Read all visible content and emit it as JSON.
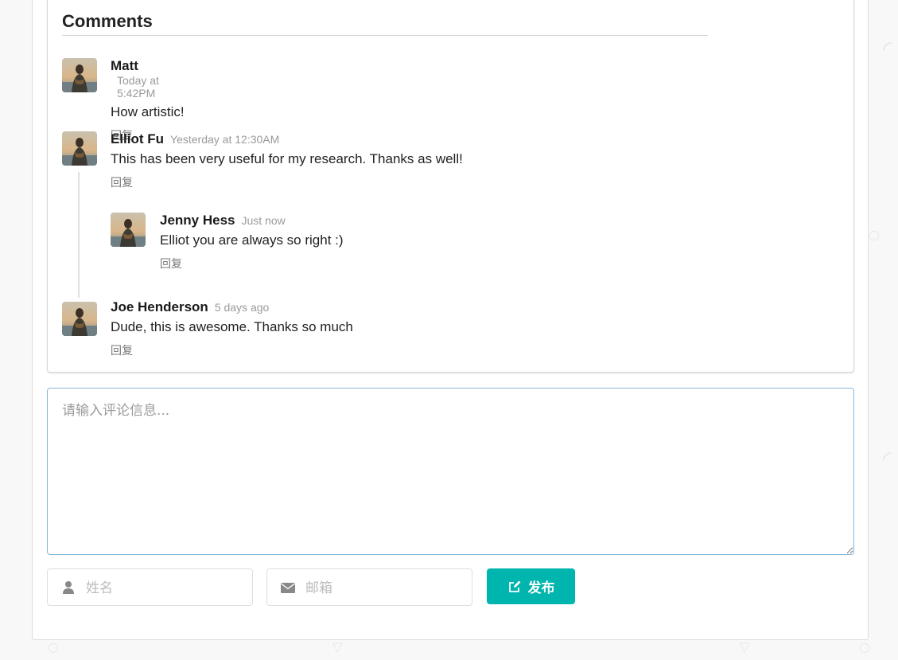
{
  "comments_section": {
    "title": "Comments",
    "reply_label": "回复",
    "comments": [
      {
        "author": "Matt",
        "time": "Today at 5:42PM",
        "text": "How artistic!"
      },
      {
        "author": "Elliot Fu",
        "time": "Yesterday at 12:30AM",
        "text": "This has been very useful for my research. Thanks as well!",
        "replies": [
          {
            "author": "Jenny Hess",
            "time": "Just now",
            "text": "Elliot you are always so right :)"
          }
        ]
      },
      {
        "author": "Joe Henderson",
        "time": "5 days ago",
        "text": "Dude, this is awesome. Thanks so much"
      }
    ]
  },
  "form": {
    "textarea_placeholder": "请输入评论信息...",
    "name_placeholder": "姓名",
    "email_placeholder": "邮箱",
    "submit_label": "发布",
    "name_icon": "user-icon",
    "email_icon": "envelope-icon",
    "submit_icon": "edit-icon"
  },
  "colors": {
    "accent": "#00b5ad",
    "focus_border": "#85b7d9"
  }
}
